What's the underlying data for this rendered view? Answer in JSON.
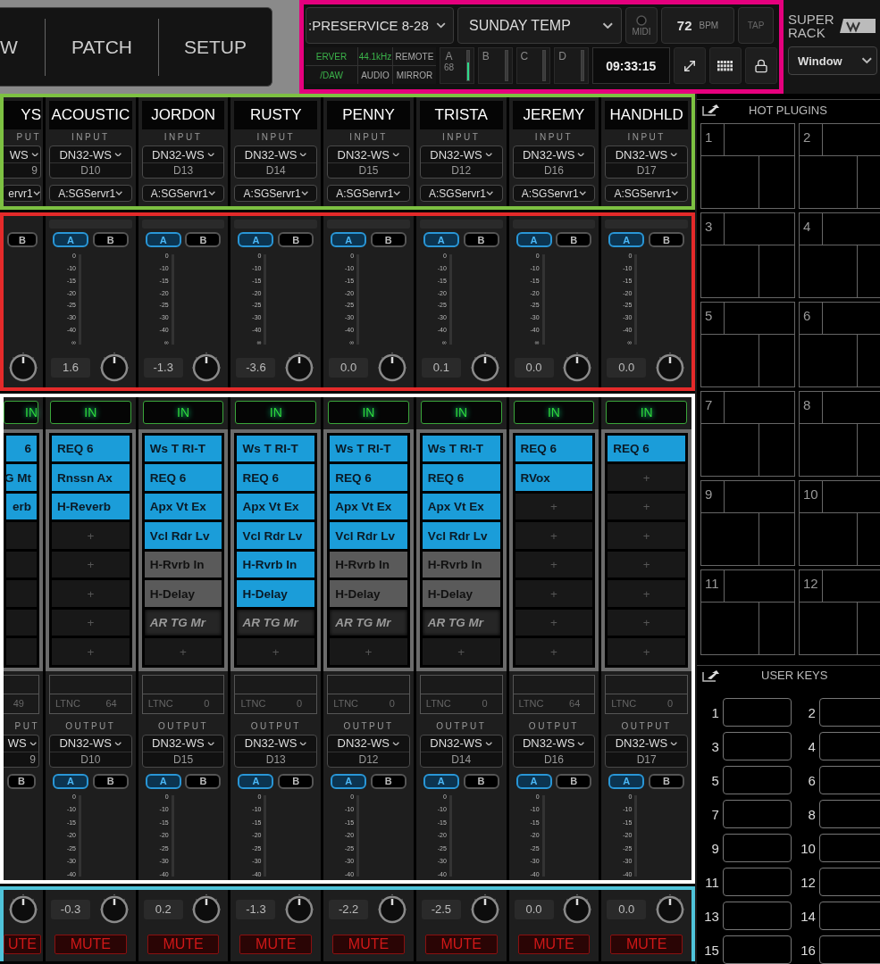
{
  "nav": {
    "tabs": [
      {
        "label": "W",
        "selected": false
      },
      {
        "label": "PATCH",
        "selected": false
      },
      {
        "label": "SETUP",
        "selected": false
      }
    ]
  },
  "transport": {
    "session": ":PRESERVICE 8-28",
    "scene": "SUNDAY TEMP",
    "midi": "MIDI",
    "bpm": "72",
    "bpm_unit": "BPM",
    "tap": "TAP",
    "status": [
      {
        "text": "ERVER",
        "on": true
      },
      {
        "text": "44.1kHz",
        "on": true
      },
      {
        "text": "REMOTE",
        "on": false
      },
      {
        "text": "/DAW",
        "on": true
      },
      {
        "text": "AUDIO",
        "on": false
      },
      {
        "text": "MIRROR",
        "on": false
      }
    ],
    "meters": [
      {
        "label": "A",
        "value": "68",
        "level": 0.6
      },
      {
        "label": "B",
        "level": 0
      },
      {
        "label": "C",
        "level": 0
      },
      {
        "label": "D",
        "level": 0
      }
    ],
    "clock": "09:33:15"
  },
  "rack": {
    "title": [
      "SUPER",
      "RACK"
    ],
    "window": "Window"
  },
  "channels": [
    {
      "kind": "partial",
      "name": "YS",
      "input": {
        "label": "PUT",
        "device": "WS",
        "port": "9",
        "network": "ervr1"
      },
      "in_buttons": [
        {
          "label": "B",
          "selected": false
        }
      ],
      "insert": {
        "label": "IN",
        "on": true
      },
      "plugins": [
        {
          "name": "6",
          "kind": "active"
        },
        {
          "name": "G Mt",
          "kind": "active"
        },
        {
          "name": "erb",
          "kind": "active"
        },
        {
          "kind": "empty"
        },
        {
          "kind": "empty"
        },
        {
          "kind": "empty"
        },
        {
          "kind": "empty"
        },
        {
          "kind": "empty"
        }
      ],
      "latency": {
        "value": "49"
      },
      "output": {
        "label": "PUT",
        "device": "WS",
        "port": "9"
      },
      "out_buttons": [
        {
          "label": "B",
          "selected": false
        }
      ],
      "mute": {
        "label": "UTE",
        "on": false
      }
    },
    {
      "kind": "full",
      "name": "ACOUSTIC",
      "input": {
        "label": "INPUT",
        "device": "DN32-WS",
        "port": "D10",
        "network": "A:SGServr1"
      },
      "in_buttons": [
        {
          "label": "A",
          "selected": true
        },
        {
          "label": "B",
          "selected": false
        }
      ],
      "in_ticks": [
        "0",
        "-10",
        "-15",
        "-20",
        "-25",
        "-30",
        "-40",
        "∞"
      ],
      "gain": "1.6",
      "insert": {
        "label": "IN",
        "on": true
      },
      "plugins": [
        {
          "name": "REQ 6",
          "kind": "active"
        },
        {
          "name": "Rnssn Ax",
          "kind": "active"
        },
        {
          "name": "H-Reverb",
          "kind": "active"
        },
        {
          "name": "+",
          "kind": "empty"
        },
        {
          "name": "+",
          "kind": "empty"
        },
        {
          "name": "+",
          "kind": "empty"
        },
        {
          "name": "+",
          "kind": "empty"
        },
        {
          "name": "+",
          "kind": "empty"
        }
      ],
      "latency": {
        "label": "LTNC",
        "value": "64"
      },
      "output": {
        "label": "OUTPUT",
        "device": "DN32-WS",
        "port": "D10"
      },
      "out_buttons": [
        {
          "label": "A",
          "selected": true
        },
        {
          "label": "B",
          "selected": false
        }
      ],
      "out_ticks": [
        "0",
        "-10",
        "-15",
        "-20",
        "-25",
        "-30",
        "-40"
      ],
      "out_gain": "-0.3",
      "mute": {
        "label": "MUTE",
        "on": false
      }
    },
    {
      "kind": "full",
      "name": "JORDON",
      "input": {
        "label": "INPUT",
        "device": "DN32-WS",
        "port": "D13",
        "network": "A:SGServr1"
      },
      "in_buttons": [
        {
          "label": "A",
          "selected": true
        },
        {
          "label": "B",
          "selected": false
        }
      ],
      "in_ticks": [
        "0",
        "-10",
        "-15",
        "-20",
        "-25",
        "-30",
        "-40",
        "∞"
      ],
      "gain": "-1.3",
      "insert": {
        "label": "IN",
        "on": true
      },
      "plugins": [
        {
          "name": "Ws T RI-T",
          "kind": "active"
        },
        {
          "name": "REQ 6",
          "kind": "active"
        },
        {
          "name": "Apx Vt Ex",
          "kind": "active"
        },
        {
          "name": "Vcl Rdr Lv",
          "kind": "active"
        },
        {
          "name": "H-Rvrb In",
          "kind": "bypassed"
        },
        {
          "name": "H-Delay",
          "kind": "bypassed"
        },
        {
          "name": "AR TG Mr",
          "kind": "muted"
        },
        {
          "name": "+",
          "kind": "empty"
        }
      ],
      "latency": {
        "label": "LTNC",
        "value": "0"
      },
      "output": {
        "label": "OUTPUT",
        "device": "DN32-WS",
        "port": "D15"
      },
      "out_buttons": [
        {
          "label": "A",
          "selected": true
        },
        {
          "label": "B",
          "selected": false
        }
      ],
      "out_ticks": [
        "0",
        "-10",
        "-15",
        "-20",
        "-25",
        "-30",
        "-40"
      ],
      "out_gain": "0.2",
      "mute": {
        "label": "MUTE",
        "on": false
      }
    },
    {
      "kind": "full",
      "name": "RUSTY",
      "input": {
        "label": "INPUT",
        "device": "DN32-WS",
        "port": "D14",
        "network": "A:SGServr1"
      },
      "in_buttons": [
        {
          "label": "A",
          "selected": true
        },
        {
          "label": "B",
          "selected": false
        }
      ],
      "in_ticks": [
        "0",
        "-10",
        "-15",
        "-20",
        "-25",
        "-30",
        "-40",
        "∞"
      ],
      "gain": "-3.6",
      "insert": {
        "label": "IN",
        "on": true
      },
      "plugins": [
        {
          "name": "Ws T RI-T",
          "kind": "active"
        },
        {
          "name": "REQ 6",
          "kind": "active"
        },
        {
          "name": "Apx Vt Ex",
          "kind": "active"
        },
        {
          "name": "Vcl Rdr Lv",
          "kind": "active"
        },
        {
          "name": "H-Rvrb In",
          "kind": "active"
        },
        {
          "name": "H-Delay",
          "kind": "active"
        },
        {
          "name": "AR TG Mr",
          "kind": "muted"
        },
        {
          "name": "+",
          "kind": "empty"
        }
      ],
      "latency": {
        "label": "LTNC",
        "value": "0"
      },
      "output": {
        "label": "OUTPUT",
        "device": "DN32-WS",
        "port": "D13"
      },
      "out_buttons": [
        {
          "label": "A",
          "selected": true
        },
        {
          "label": "B",
          "selected": false
        }
      ],
      "out_ticks": [
        "0",
        "-10",
        "-15",
        "-20",
        "-25",
        "-30",
        "-40"
      ],
      "out_gain": "-1.3",
      "mute": {
        "label": "MUTE",
        "on": false
      }
    },
    {
      "kind": "full",
      "name": "PENNY",
      "input": {
        "label": "INPUT",
        "device": "DN32-WS",
        "port": "D15",
        "network": "A:SGServr1"
      },
      "in_buttons": [
        {
          "label": "A",
          "selected": true
        },
        {
          "label": "B",
          "selected": false
        }
      ],
      "in_ticks": [
        "0",
        "-10",
        "-15",
        "-20",
        "-25",
        "-30",
        "-40",
        "∞"
      ],
      "gain": "0.0",
      "insert": {
        "label": "IN",
        "on": true
      },
      "plugins": [
        {
          "name": "Ws T RI-T",
          "kind": "active"
        },
        {
          "name": "REQ 6",
          "kind": "active"
        },
        {
          "name": "Apx Vt Ex",
          "kind": "active"
        },
        {
          "name": "Vcl Rdr Lv",
          "kind": "active"
        },
        {
          "name": "H-Rvrb In",
          "kind": "bypassed"
        },
        {
          "name": "H-Delay",
          "kind": "bypassed"
        },
        {
          "name": "AR TG Mr",
          "kind": "muted"
        },
        {
          "name": "+",
          "kind": "empty"
        }
      ],
      "latency": {
        "label": "LTNC",
        "value": "0"
      },
      "output": {
        "label": "OUTPUT",
        "device": "DN32-WS",
        "port": "D12"
      },
      "out_buttons": [
        {
          "label": "A",
          "selected": true
        },
        {
          "label": "B",
          "selected": false
        }
      ],
      "out_ticks": [
        "0",
        "-10",
        "-15",
        "-20",
        "-25",
        "-30",
        "-40"
      ],
      "out_gain": "-2.2",
      "mute": {
        "label": "MUTE",
        "on": false
      }
    },
    {
      "kind": "full",
      "name": "TRISTA",
      "input": {
        "label": "INPUT",
        "device": "DN32-WS",
        "port": "D12",
        "network": "A:SGServr1"
      },
      "in_buttons": [
        {
          "label": "A",
          "selected": true
        },
        {
          "label": "B",
          "selected": false
        }
      ],
      "in_ticks": [
        "0",
        "-10",
        "-15",
        "-20",
        "-25",
        "-30",
        "-40",
        "∞"
      ],
      "gain": "0.1",
      "insert": {
        "label": "IN",
        "on": true
      },
      "plugins": [
        {
          "name": "Ws T RI-T",
          "kind": "active"
        },
        {
          "name": "REQ 6",
          "kind": "active"
        },
        {
          "name": "Apx Vt Ex",
          "kind": "active"
        },
        {
          "name": "Vcl Rdr Lv",
          "kind": "active"
        },
        {
          "name": "H-Rvrb In",
          "kind": "bypassed"
        },
        {
          "name": "H-Delay",
          "kind": "bypassed"
        },
        {
          "name": "AR TG Mr",
          "kind": "muted"
        },
        {
          "name": "+",
          "kind": "empty"
        }
      ],
      "latency": {
        "label": "LTNC",
        "value": "0"
      },
      "output": {
        "label": "OUTPUT",
        "device": "DN32-WS",
        "port": "D14"
      },
      "out_buttons": [
        {
          "label": "A",
          "selected": true
        },
        {
          "label": "B",
          "selected": false
        }
      ],
      "out_ticks": [
        "0",
        "-10",
        "-15",
        "-20",
        "-25",
        "-30",
        "-40"
      ],
      "out_gain": "-2.5",
      "mute": {
        "label": "MUTE",
        "on": false
      }
    },
    {
      "kind": "full",
      "name": "JEREMY",
      "input": {
        "label": "INPUT",
        "device": "DN32-WS",
        "port": "D16",
        "network": "A:SGServr1"
      },
      "in_buttons": [
        {
          "label": "A",
          "selected": true
        },
        {
          "label": "B",
          "selected": false
        }
      ],
      "in_ticks": [
        "0",
        "-10",
        "-15",
        "-20",
        "-25",
        "-30",
        "-40",
        "∞"
      ],
      "gain": "0.0",
      "insert": {
        "label": "IN",
        "on": true
      },
      "plugins": [
        {
          "name": "REQ 6",
          "kind": "active"
        },
        {
          "name": "RVox",
          "kind": "active"
        },
        {
          "name": "+",
          "kind": "empty"
        },
        {
          "name": "+",
          "kind": "empty"
        },
        {
          "name": "+",
          "kind": "empty"
        },
        {
          "name": "+",
          "kind": "empty"
        },
        {
          "name": "+",
          "kind": "empty"
        },
        {
          "name": "+",
          "kind": "empty"
        }
      ],
      "latency": {
        "label": "LTNC",
        "value": "64"
      },
      "output": {
        "label": "OUTPUT",
        "device": "DN32-WS",
        "port": "D16"
      },
      "out_buttons": [
        {
          "label": "A",
          "selected": true
        },
        {
          "label": "B",
          "selected": false
        }
      ],
      "out_ticks": [
        "0",
        "-10",
        "-15",
        "-20",
        "-25",
        "-30",
        "-40"
      ],
      "out_gain": "0.0",
      "mute": {
        "label": "MUTE",
        "on": false
      }
    },
    {
      "kind": "full",
      "name": "HANDHLD",
      "input": {
        "label": "INPUT",
        "device": "DN32-WS",
        "port": "D17",
        "network": "A:SGServr1"
      },
      "in_buttons": [
        {
          "label": "A",
          "selected": true
        },
        {
          "label": "B",
          "selected": false
        }
      ],
      "in_ticks": [
        "0",
        "-10",
        "-15",
        "-20",
        "-25",
        "-30",
        "-40",
        "∞"
      ],
      "gain": "0.0",
      "insert": {
        "label": "IN",
        "on": true
      },
      "plugins": [
        {
          "name": "REQ 6",
          "kind": "active"
        },
        {
          "name": "+",
          "kind": "empty"
        },
        {
          "name": "+",
          "kind": "empty"
        },
        {
          "name": "+",
          "kind": "empty"
        },
        {
          "name": "+",
          "kind": "empty"
        },
        {
          "name": "+",
          "kind": "empty"
        },
        {
          "name": "+",
          "kind": "empty"
        },
        {
          "name": "+",
          "kind": "empty"
        }
      ],
      "latency": {
        "label": "LTNC",
        "value": "0"
      },
      "output": {
        "label": "OUTPUT",
        "device": "DN32-WS",
        "port": "D17"
      },
      "out_buttons": [
        {
          "label": "A",
          "selected": true
        },
        {
          "label": "B",
          "selected": false
        }
      ],
      "out_ticks": [
        "0",
        "-10",
        "-15",
        "-20",
        "-25",
        "-30",
        "-40"
      ],
      "out_gain": "0.0",
      "mute": {
        "label": "MUTE",
        "on": false
      }
    }
  ],
  "hot_plugins": {
    "title": "HOT PLUGINS",
    "slots": [
      "1",
      "2",
      "3",
      "4",
      "5",
      "6",
      "7",
      "8",
      "9",
      "10",
      "11",
      "12"
    ]
  },
  "user_keys": {
    "title": "USER KEYS",
    "keys": [
      "1",
      "2",
      "3",
      "4",
      "5",
      "6",
      "7",
      "8",
      "9",
      "10",
      "11",
      "12",
      "13",
      "14",
      "15",
      "16"
    ]
  }
}
